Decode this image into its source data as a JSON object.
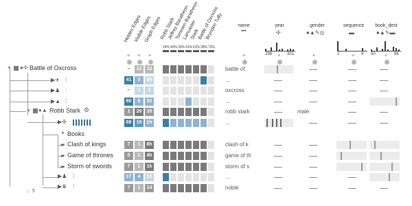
{
  "colors": {
    "dark": "#7a7a7a",
    "mid": "#b8b8b8",
    "light": "#d9d9d9",
    "blue_dark": "#3d7fa3",
    "blue_mid": "#8fb3cf",
    "blue_light": "#c4d8e6",
    "tree": "#9a9a9a"
  },
  "columns": {
    "rotated": [
      "Hidden Edges",
      "Visible Edges",
      "Graph Edges"
    ],
    "heat_headers": [
      "Robb Stark",
      "Jeffrey Baratheon",
      "Tommen Baratheon",
      "Lancaster",
      "Stark",
      "Battle of Oxcross",
      "Brynden Tully"
    ],
    "heat_percents": [
      "24%",
      "40%",
      "33%",
      "41%",
      "61%",
      "28%",
      "73%"
    ],
    "name": "name",
    "year": "year",
    "gender": "gender",
    "sequence": "sequence",
    "book_dest": "book_dest",
    "year_ticks": [
      "298",
      "301"
    ],
    "seq_ticks": [
      "1",
      "4"
    ],
    "book_ticks": [
      "50",
      "86"
    ],
    "name_icon": "•••"
  },
  "tree": {
    "root": "Battle of Oxcross",
    "person": "Robb Stark",
    "books_group": "Books",
    "books": [
      "Clash of kings",
      "Game of thrones",
      "Storm of swords"
    ],
    "footer_count": "5"
  },
  "rows": [
    {
      "c1": "–",
      "c2": "12",
      "c3": "12",
      "name": "battle of",
      "gender": ""
    },
    {
      "c1": "41",
      "c2": "3",
      "c3": "3h",
      "name": "...",
      "gender": ""
    },
    {
      "c1": "–",
      "c2": "1",
      "c3": "2",
      "name": "oxcross",
      "gender": ""
    },
    {
      "c1": "60",
      "c2": "6",
      "c3": "52",
      "name": "...",
      "gender": ""
    },
    {
      "c1": "1",
      "c2": "29",
      "c3": "35",
      "name": "robb stark",
      "gender": "male"
    },
    {
      "c1": "69",
      "c2": "19",
      "c3": "1h",
      "name": "...",
      "gender": ""
    },
    {
      "c1": "",
      "c2": "",
      "c3": "",
      "name": "",
      "gender": ""
    },
    {
      "c1": "7",
      "c2": "1",
      "c3": "8h",
      "name": "clash of k",
      "gender": ""
    },
    {
      "c1": "5",
      "c2": "1",
      "c3": "4h",
      "name": "game of th",
      "gender": ""
    },
    {
      "c1": "7",
      "c2": "1",
      "c3": "1k",
      "name": "storm of s",
      "gender": ""
    },
    {
      "c1": "17",
      "c2": "4",
      "c3": "13",
      "name": "...",
      "gender": ""
    },
    {
      "c1": "7",
      "c2": "1",
      "c3": "14",
      "name": "noble",
      "gender": ""
    }
  ]
}
